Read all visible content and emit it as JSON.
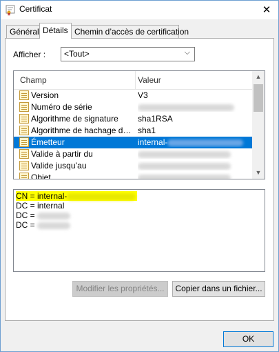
{
  "window": {
    "title": "Certificat",
    "close_glyph": "✕"
  },
  "tabs": [
    {
      "label": "Général"
    },
    {
      "label": "Détails"
    },
    {
      "label": "Chemin d’accès de certification"
    }
  ],
  "show": {
    "label": "Afficher :",
    "value": "<Tout>"
  },
  "list": {
    "columns": {
      "field": "Champ",
      "value": "Valeur"
    },
    "rows": [
      {
        "field": "Version",
        "value": "V3"
      },
      {
        "field": "Numéro de série",
        "value": ""
      },
      {
        "field": "Algorithme de signature",
        "value": "sha1RSA"
      },
      {
        "field": "Algorithme de hachage de l...",
        "value": "sha1"
      },
      {
        "field": "Émetteur",
        "value": "internal-"
      },
      {
        "field": "Valide à partir du",
        "value": ""
      },
      {
        "field": "Valide jusqu’au",
        "value": ""
      },
      {
        "field": "Objet",
        "value": ""
      }
    ]
  },
  "details": {
    "lines": [
      "CN = internal-",
      "DC = internal",
      "DC = ",
      "DC = "
    ]
  },
  "buttons": {
    "edit": "Modifier les propriétés...",
    "copy": "Copier dans un fichier...",
    "ok": "OK"
  },
  "colors": {
    "selection": "#0078d7",
    "highlight": "#ffff00"
  }
}
